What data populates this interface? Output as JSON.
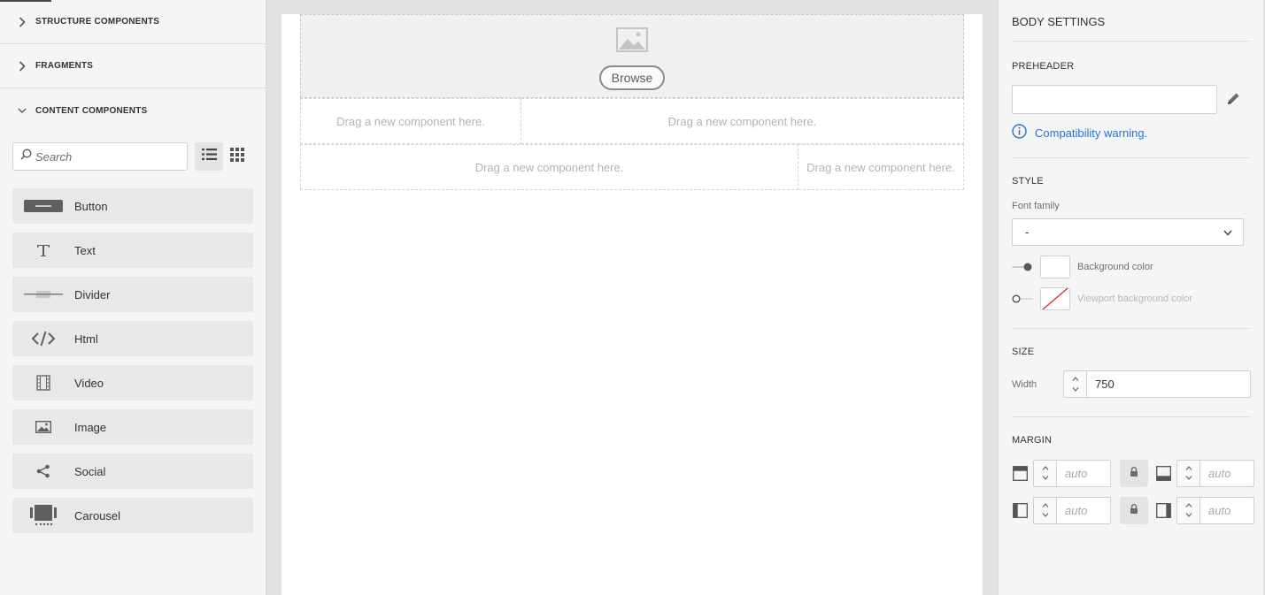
{
  "left_panel": {
    "sections": [
      {
        "label": "STRUCTURE COMPONENTS",
        "expanded": false
      },
      {
        "label": "FRAGMENTS",
        "expanded": false
      },
      {
        "label": "CONTENT COMPONENTS",
        "expanded": true
      }
    ],
    "search": {
      "placeholder": "Search",
      "value": ""
    },
    "view_modes": {
      "active": "list"
    },
    "components": [
      {
        "label": "Button",
        "icon": "button-icon"
      },
      {
        "label": "Text",
        "icon": "text-icon"
      },
      {
        "label": "Divider",
        "icon": "divider-icon"
      },
      {
        "label": "Html",
        "icon": "code-icon"
      },
      {
        "label": "Video",
        "icon": "video-icon"
      },
      {
        "label": "Image",
        "icon": "image-icon"
      },
      {
        "label": "Social",
        "icon": "share-icon"
      },
      {
        "label": "Carousel",
        "icon": "carousel-icon"
      }
    ]
  },
  "canvas": {
    "browse_label": "Browse",
    "drop_placeholder": "Drag a new component here.",
    "rows": [
      [
        "Drag a new component here.",
        "Drag a new component here."
      ],
      [
        "Drag a new component here.",
        "Drag a new component here."
      ]
    ]
  },
  "right_panel": {
    "title": "BODY SETTINGS",
    "preheader": {
      "heading": "PREHEADER",
      "value": "",
      "warning": "Compatibility warning."
    },
    "style": {
      "heading": "STYLE",
      "font_family_label": "Font family",
      "font_family_value": "-",
      "background_color_label": "Background color",
      "background_color_enabled": true,
      "background_color": "#ffffff",
      "viewport_color_label": "Viewport background color",
      "viewport_color_enabled": false
    },
    "size": {
      "heading": "SIZE",
      "width_label": "Width",
      "width_value": "750"
    },
    "margin": {
      "heading": "MARGIN",
      "top": "auto",
      "bottom": "auto",
      "left": "auto",
      "right": "auto"
    }
  },
  "colors": {
    "link_blue": "#2d73c5",
    "panel_bg": "#f5f5f5",
    "canvas_bg": "#e1e1e1"
  }
}
